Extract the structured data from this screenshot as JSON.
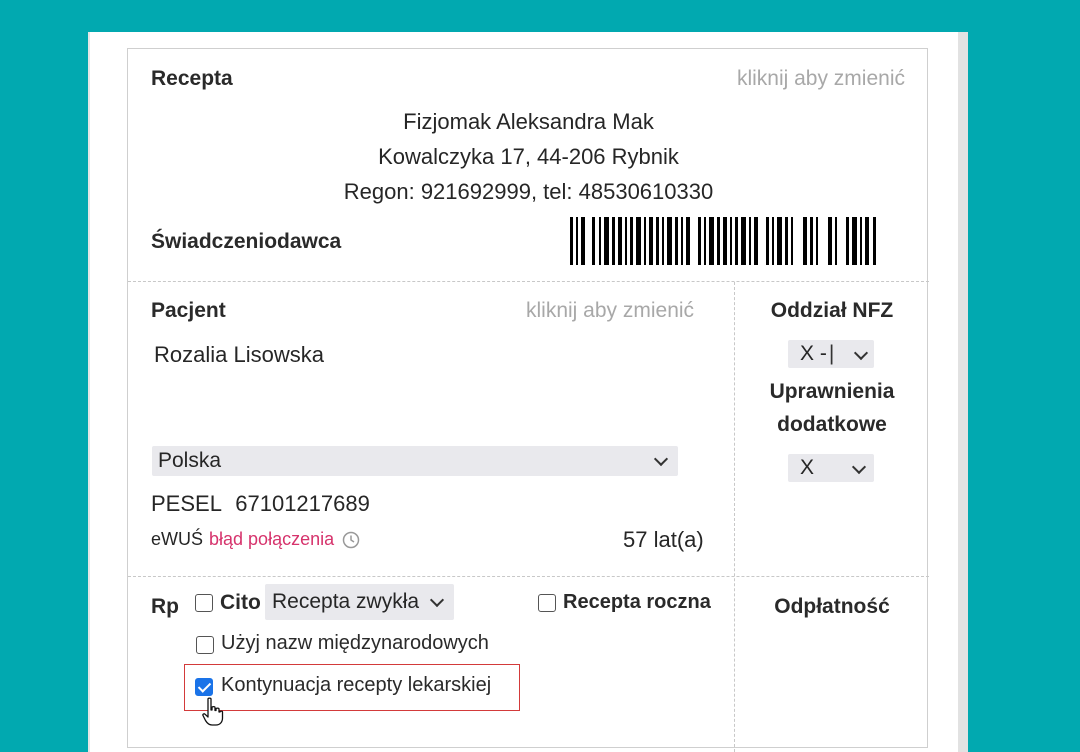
{
  "recepta": {
    "title": "Recepta",
    "change_hint": "kliknij aby zmienić",
    "provider_name": "Fizjomak Aleksandra Mak",
    "provider_address": "Kowalczyka  17, 44-206 Rybnik",
    "provider_regon": "Regon: 921692999, tel: 48530610330",
    "provider_label": "Świadczeniodawca"
  },
  "pacjent": {
    "title": "Pacjent",
    "change_hint": "kliknij aby zmienić",
    "name": "Rozalia Lisowska",
    "country": "Polska",
    "pesel_label": "PESEL",
    "pesel": "67101217689",
    "ewus_label": "eWUŚ",
    "ewus_status": "błąd połączenia",
    "age": "57  lat(a)"
  },
  "nfz": {
    "title": "Oddział NFZ",
    "branch_value": "X  -",
    "rights_title_1": "Uprawnienia",
    "rights_title_2": "dodatkowe",
    "rights_value": "X"
  },
  "rp": {
    "label": "Rp",
    "cito_label": "Cito",
    "cito_checked": false,
    "type_value": "Recepta zwykła",
    "annual_label": "Recepta roczna",
    "annual_checked": false,
    "intl_names_label": "Użyj nazw międzynarodowych",
    "intl_names_checked": false,
    "continuation_label": "Kontynuacja recepty lekarskiej",
    "continuation_checked": true,
    "payment_label": "Odpłatność"
  },
  "colors": {
    "background": "#01a9b0",
    "error_text": "#d6336c",
    "checkbox_checked": "#1a73e8",
    "highlight_border": "#d33a3a"
  }
}
